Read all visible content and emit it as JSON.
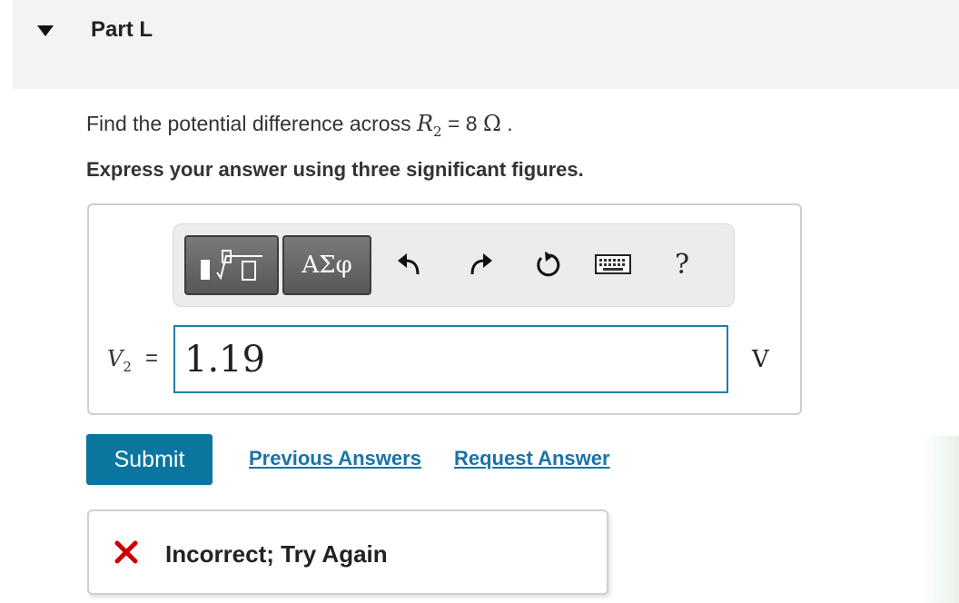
{
  "part": {
    "title": "Part L"
  },
  "question": {
    "prefix": "Find the potential difference across ",
    "variable": "R",
    "subscript": "2",
    "equals": " = 8 ",
    "unit_symbol": "Ω",
    "suffix": " ."
  },
  "instruction": "Express your answer using three significant figures.",
  "toolbar": {
    "greek_label": "ΑΣφ",
    "help_label": "?",
    "icons": [
      "templates-icon",
      "greek-letters-icon",
      "undo-icon",
      "redo-icon",
      "reset-icon",
      "keyboard-icon",
      "help-icon"
    ]
  },
  "answer": {
    "variable": "V",
    "subscript": "2",
    "equals": "=",
    "value": "1.19",
    "unit": "V"
  },
  "actions": {
    "submit_label": "Submit",
    "previous_answers_label": "Previous Answers",
    "request_answer_label": "Request Answer"
  },
  "feedback": {
    "text": "Incorrect; Try Again",
    "status_color": "#cc0000"
  },
  "colors": {
    "accent": "#0a76a0",
    "link": "#1a73a8",
    "input_border": "#1f7fa3"
  }
}
